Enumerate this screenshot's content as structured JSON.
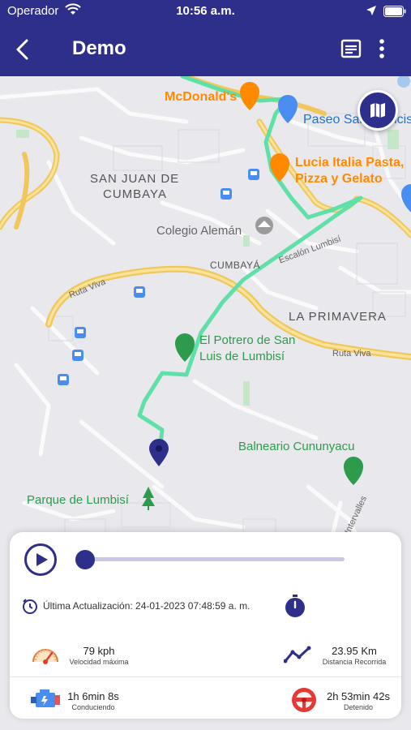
{
  "status_bar": {
    "carrier": "Operador",
    "time": "10:56 a.m."
  },
  "header": {
    "title": "Demo"
  },
  "map": {
    "labels": {
      "mcdonalds": "McDonald's",
      "paseo": "Paseo San Francis",
      "lucia_line1": "Lucia Italia Pasta,",
      "lucia_line2": "Pizza y Gelato",
      "san_juan_line1": "SAN JUAN DE",
      "san_juan_line2": "CUMBAYA",
      "colegio": "Colegio Alemán",
      "cumbaya": "CUMBAYÁ",
      "escalon": "Escalón Lumbisí",
      "ruta_viva_left": "Ruta Viva",
      "ruta_viva_right": "Ruta Viva",
      "la_primavera": "LA PRIMAVERA",
      "potrero_line1": "El Potrero de San",
      "potrero_line2": "Luis de Lumbisí",
      "balneario": "Balneario Cununyacu",
      "parque": "Parque de Lumbisí",
      "intervalles": "Intervalles"
    },
    "route_color": "#5fe0a8",
    "accent_color": "#2e2f8a"
  },
  "playback": {
    "progress": 0.0
  },
  "info": {
    "last_update": "Última Actualización: 24-01-2023 07:48:59 a. m."
  },
  "stats": {
    "max_speed": {
      "value": "79 kph",
      "label": "Velocidad máxima"
    },
    "distance": {
      "value": "23.95 Km",
      "label": "Distancia Recorrida"
    },
    "driving": {
      "value": "1h 6min 8s",
      "label": "Conduciendo"
    },
    "stopped": {
      "value": "2h 53min 42s",
      "label": "Detenido"
    }
  }
}
